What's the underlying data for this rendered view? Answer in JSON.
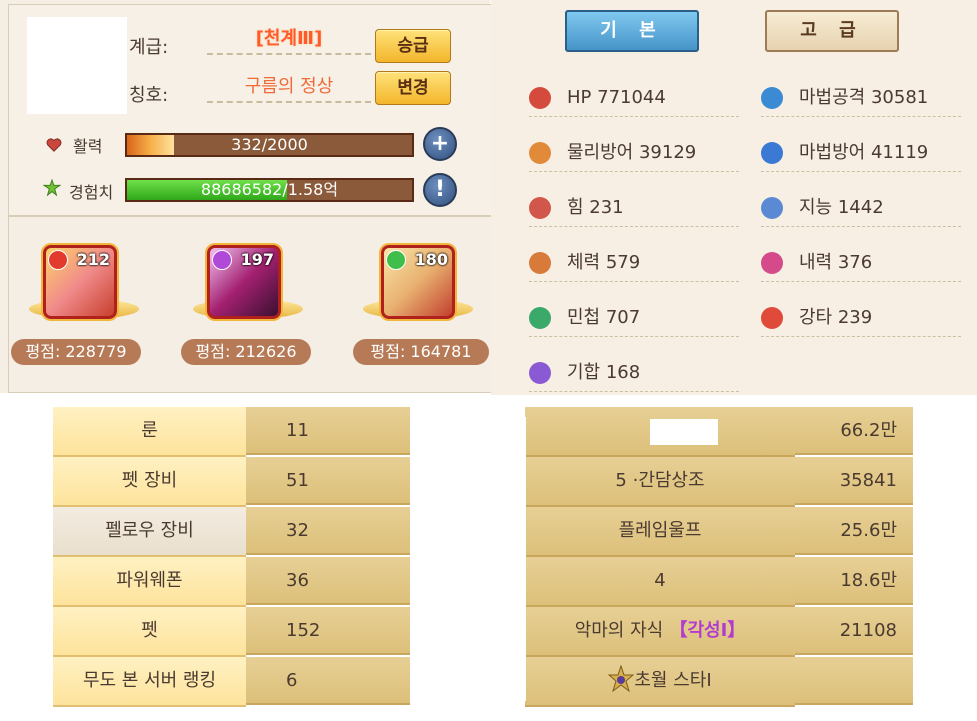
{
  "profile": {
    "rank_label": "계급:",
    "rank_value": "[천계Ⅲ]",
    "promote_button": "승급",
    "title_label": "칭호:",
    "title_value": "구름의 정상",
    "change_button": "변경",
    "stamina_label": "활력",
    "stamina_text": "332/2000",
    "stamina_fraction": 0.166,
    "exp_label": "경험치",
    "exp_text": "88686582/1.58억",
    "exp_fraction": 0.561,
    "add_icon": "plus-icon",
    "info_icon": "exclamation-icon"
  },
  "heroes": [
    {
      "level": "212",
      "score": "평점: 228779",
      "color": "#e23b2d"
    },
    {
      "level": "197",
      "score": "평점: 212626",
      "color": "#b048d8"
    },
    {
      "level": "180",
      "score": "평점: 164781",
      "color": "#3fbf4a"
    }
  ],
  "tabs": {
    "basic": "기 본",
    "advanced": "고 급"
  },
  "stats_left": [
    {
      "text": "HP 771044",
      "icon": "heart-icon",
      "color": "#d44a3c"
    },
    {
      "text": "물리방어  39129",
      "icon": "shield-icon",
      "color": "#e08a3a"
    },
    {
      "text": "힘  231",
      "icon": "strength-icon",
      "color": "#d2574a"
    },
    {
      "text": "체력  579",
      "icon": "vitality-icon",
      "color": "#d77a3a"
    },
    {
      "text": "민첩  707",
      "icon": "agility-icon",
      "color": "#3aa96a"
    },
    {
      "text": "기합  168",
      "icon": "spirit-icon",
      "color": "#8a5ad4"
    }
  ],
  "stats_right": [
    {
      "text": "마법공격  30581",
      "icon": "magic-attack-icon",
      "color": "#3a8ad4"
    },
    {
      "text": "마법방어  41119",
      "icon": "magic-defense-icon",
      "color": "#3a7ad4"
    },
    {
      "text": "지능  1442",
      "icon": "intelligence-icon",
      "color": "#5a8ad4"
    },
    {
      "text": "내력  376",
      "icon": "inner-power-icon",
      "color": "#d44a8a"
    },
    {
      "text": "강타  239",
      "icon": "critical-icon",
      "color": "#e04a3a"
    }
  ],
  "table": {
    "rows": [
      {
        "label": "룬",
        "value": "11",
        "name": "",
        "num": "66.2만"
      },
      {
        "label": "펫 장비",
        "value": "51",
        "name": "5   ·간담상조",
        "num": "35841"
      },
      {
        "label": "펠로우 장비",
        "value": "32",
        "name": "플레임울프",
        "num": "25.6만"
      },
      {
        "label": "파워웨폰",
        "value": "36",
        "name": "4",
        "num": "18.6만"
      },
      {
        "label": "펫",
        "value": "152",
        "name": "악마의 자식",
        "tag": "【각성Ⅰ】",
        "num": "21108"
      },
      {
        "label": "무도 본 서버 랭킹",
        "value": "6",
        "name": "초월 스타Ⅰ",
        "num": ""
      }
    ]
  }
}
